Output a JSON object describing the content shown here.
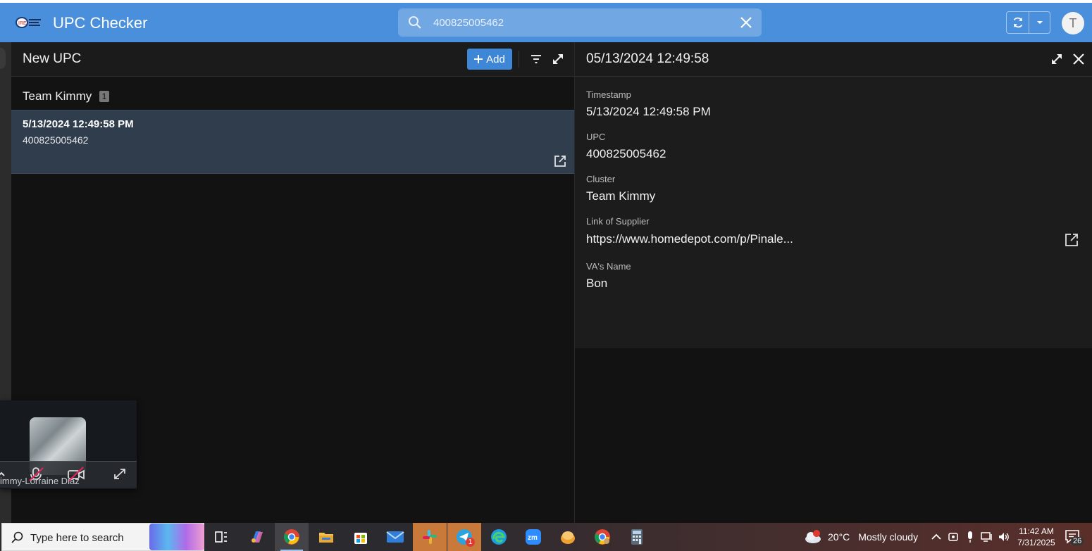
{
  "app": {
    "title": "UPC Checker",
    "avatar_letter": "T"
  },
  "search": {
    "value": "400825005462",
    "placeholder": "Search"
  },
  "list": {
    "title": "New UPC",
    "add_label": "Add",
    "group": {
      "label": "Team Kimmy",
      "count": "1"
    },
    "rows": [
      {
        "timestamp": "5/13/2024 12:49:58 PM",
        "upc": "400825005462"
      }
    ]
  },
  "detail": {
    "title": "05/13/2024 12:49:58",
    "fields": [
      {
        "label": "Timestamp",
        "value": "5/13/2024 12:49:58 PM"
      },
      {
        "label": "UPC",
        "value": "400825005462"
      },
      {
        "label": "Cluster",
        "value": "Team Kimmy"
      },
      {
        "label": "Link of Supplier",
        "value": "https://www.homedepot.com/p/Pinale..."
      },
      {
        "label": "VA's Name",
        "value": "Bon"
      }
    ]
  },
  "call": {
    "participant": "immy-Lorraine Diaz"
  },
  "taskbar": {
    "search_text": "Type here to search",
    "apps": [
      "task-view",
      "copilot",
      "chrome",
      "file-explorer",
      "microsoft-store",
      "mail",
      "slack",
      "telegram",
      "edge",
      "zoom",
      "app-orange",
      "chrome-profile",
      "calculator"
    ],
    "telegram_badge": "1",
    "weather": {
      "temp": "20°C",
      "condition": "Mostly cloudy",
      "alert": "1"
    },
    "time": "11:42 AM",
    "date": "7/31/2025",
    "notifications": "26"
  },
  "colors": {
    "appbar": "#4a8fdb",
    "accent": "#3d87d6",
    "selected_row": "#2f3d4d",
    "panel": "#1c1c1c"
  }
}
